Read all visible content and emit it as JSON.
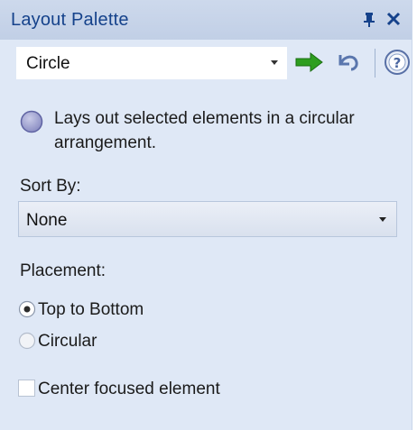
{
  "window": {
    "title": "Layout Palette",
    "pin_icon": "pin-icon",
    "close_icon": "close-icon"
  },
  "toolbar": {
    "layout_type": "Circle",
    "apply_icon": "green-arrow-right-icon",
    "undo_icon": "undo-icon",
    "help_icon": "help-icon"
  },
  "description": {
    "icon": "circle-layout-icon",
    "text": "Lays out selected elements in a circular arrangement."
  },
  "sort": {
    "label": "Sort By:",
    "value": "None"
  },
  "placement": {
    "label": "Placement:",
    "options": [
      {
        "label": "Top to Bottom",
        "selected": true
      },
      {
        "label": "Circular",
        "selected": false
      }
    ]
  },
  "center_focused": {
    "label": "Center focused element",
    "checked": false
  },
  "colors": {
    "panel_background": "#dfe8f6",
    "titlebar_text": "#15428b",
    "apply_arrow": "#2e9e1f"
  }
}
